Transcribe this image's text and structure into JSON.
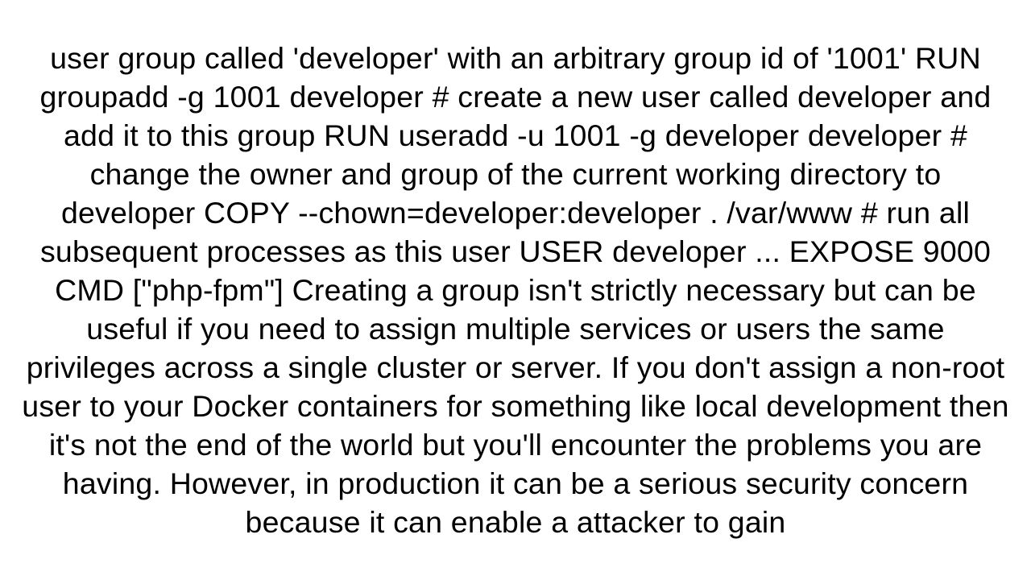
{
  "document": {
    "text": "user group called 'developer' with an arbitrary group id of '1001' RUN groupadd -g 1001 developer  # create a new user called developer and add it to this group RUN useradd -u 1001 -g developer developer  # change the owner and group of the current working directory to developer COPY --chown=developer:developer . /var/www  # run all subsequent processes as this user USER developer  ...  EXPOSE 9000  CMD [\"php-fpm\"]  Creating a group isn't strictly necessary but can be useful if you need to assign multiple services or users the same privileges across a single cluster or server. If you don't assign a non-root user to your Docker containers for something like local development then it's not the end of the world but you'll encounter the problems you are having. However, in production it can be a serious security concern because it can enable a attacker to gain"
  }
}
